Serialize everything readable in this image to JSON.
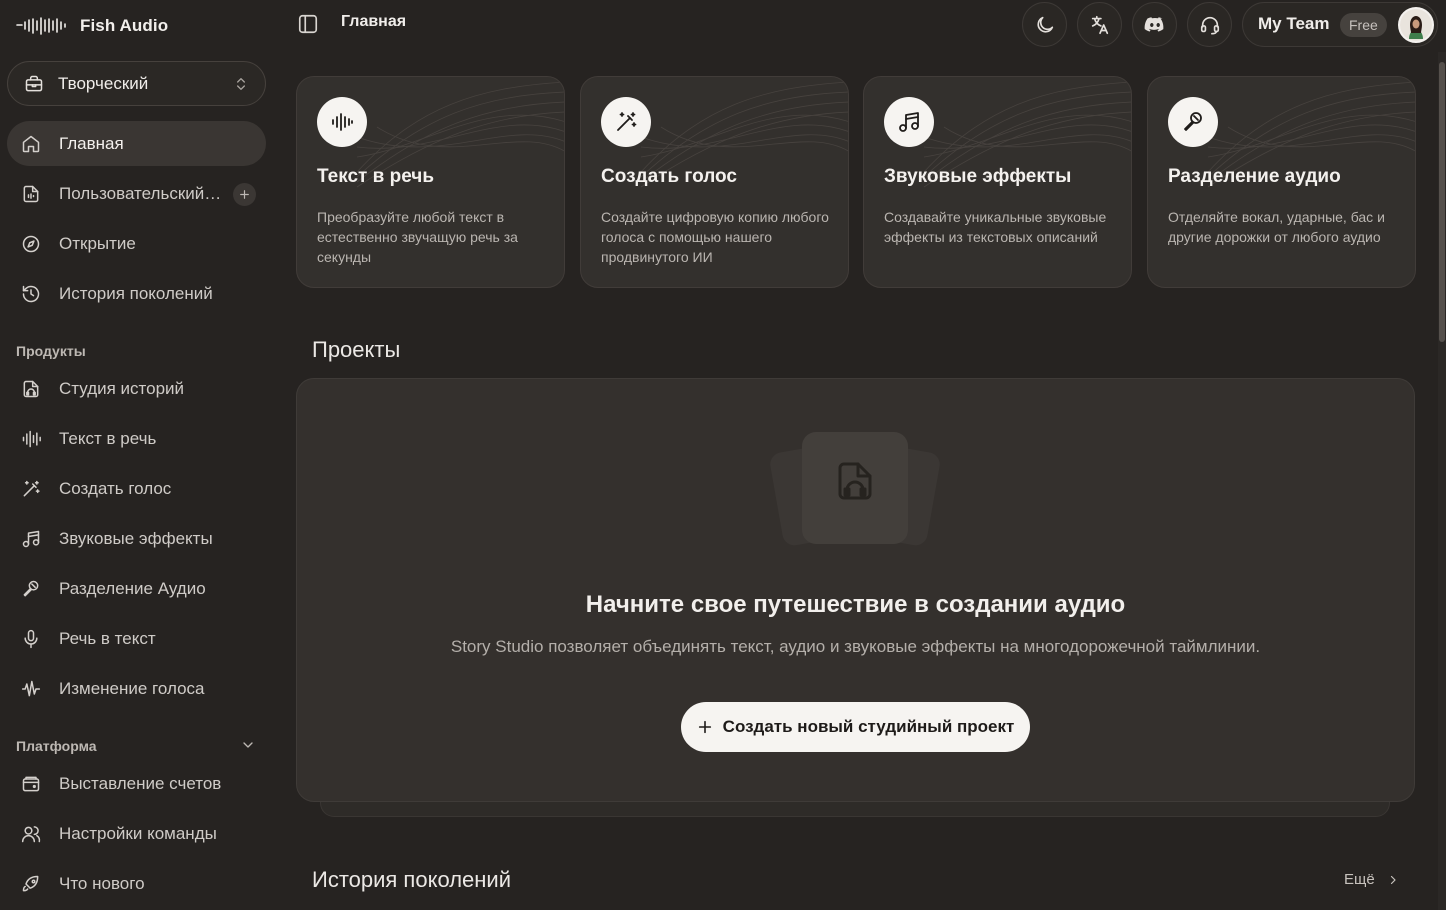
{
  "brand": {
    "name": "Fish Audio"
  },
  "workspace": {
    "label": "Творческий"
  },
  "sidebar": {
    "main_items": [
      {
        "label": "Главная",
        "icon": "home-icon",
        "active": true
      },
      {
        "label": "Пользовательский голос",
        "icon": "custom-voice-icon"
      },
      {
        "label": "Открытие",
        "icon": "compass-icon"
      },
      {
        "label": "История поколений",
        "icon": "history-icon"
      }
    ],
    "products_label": "Продукты",
    "products": [
      {
        "label": "Студия историй",
        "icon": "story-studio-icon"
      },
      {
        "label": "Текст в речь",
        "icon": "audio-lines-icon"
      },
      {
        "label": "Создать голос",
        "icon": "magic-wand-icon"
      },
      {
        "label": "Звуковые эффекты",
        "icon": "music-note-icon"
      },
      {
        "label": "Разделение Аудио",
        "icon": "microphone-icon"
      },
      {
        "label": "Речь в текст",
        "icon": "mic-icon"
      },
      {
        "label": "Изменение голоса",
        "icon": "voice-wave-icon"
      }
    ],
    "platform_label": "Платформа",
    "platform": [
      {
        "label": "Выставление счетов",
        "icon": "wallet-icon"
      },
      {
        "label": "Настройки команды",
        "icon": "users-icon"
      },
      {
        "label": "Что нового",
        "icon": "rocket-icon"
      }
    ]
  },
  "header": {
    "title": "Главная",
    "team_name": "My Team",
    "plan": "Free"
  },
  "cards": [
    {
      "title": "Текст в речь",
      "desc": "Преобразуйте любой текст в естественно звучащую речь за секунды",
      "icon": "audio-lines-icon"
    },
    {
      "title": "Создать голос",
      "desc": "Создайте цифровую копию любого голоса с помощью нашего продвинутого ИИ",
      "icon": "magic-wand-icon"
    },
    {
      "title": "Звуковые эффекты",
      "desc": "Создавайте уникальные звуковые эффекты из текстовых описаний",
      "icon": "music-note-icon"
    },
    {
      "title": "Разделение аудио",
      "desc": "Отделяйте вокал, ударные, бас и другие дорожки от любого аудио",
      "icon": "microphone-icon"
    }
  ],
  "projects": {
    "heading": "Проекты",
    "empty_title": "Начните свое путешествие в создании аудио",
    "empty_desc": "Story Studio позволяет объединять текст, аудио и звуковые эффекты на многодорожечной таймлинии.",
    "cta": "Создать новый студийный проект"
  },
  "history": {
    "heading": "История поколений",
    "more": "Ещё"
  },
  "colors": {
    "background": "#262321",
    "card": "#33302d",
    "accent_button": "#f6f4f1"
  }
}
